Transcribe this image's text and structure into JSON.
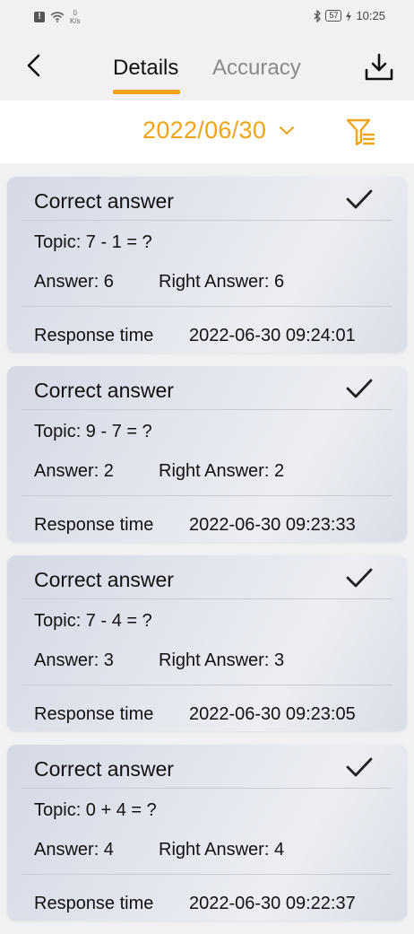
{
  "status_bar": {
    "speed_value": "0",
    "speed_unit": "K/s",
    "battery": "57",
    "time": "10:25"
  },
  "header": {
    "tabs": [
      {
        "label": "Details",
        "active": true
      },
      {
        "label": "Accuracy",
        "active": false
      }
    ],
    "icons": [
      "back-arrow-icon",
      "download-icon"
    ]
  },
  "filter": {
    "date": "2022/06/30",
    "icons": [
      "chevron-down-icon",
      "filter-icon"
    ],
    "accent_color": "#f0a41a"
  },
  "records": [
    {
      "status": "Correct answer",
      "topic": "Topic: 7 - 1 =  ?",
      "answer": "Answer: 6",
      "right_answer": "Right Answer: 6",
      "response_label": "Response time",
      "response_time": "2022-06-30 09:24:01"
    },
    {
      "status": "Correct answer",
      "topic": "Topic: 9 - 7 =  ?",
      "answer": "Answer: 2",
      "right_answer": "Right Answer: 2",
      "response_label": "Response time",
      "response_time": "2022-06-30 09:23:33"
    },
    {
      "status": "Correct answer",
      "topic": "Topic: 7 - 4 =  ?",
      "answer": "Answer: 3",
      "right_answer": "Right Answer: 3",
      "response_label": "Response time",
      "response_time": "2022-06-30 09:23:05"
    },
    {
      "status": "Correct answer",
      "topic": "Topic: 0 + 4 =  ?",
      "answer": "Answer: 4",
      "right_answer": "Right Answer: 4",
      "response_label": "Response time",
      "response_time": "2022-06-30 09:22:37"
    }
  ]
}
